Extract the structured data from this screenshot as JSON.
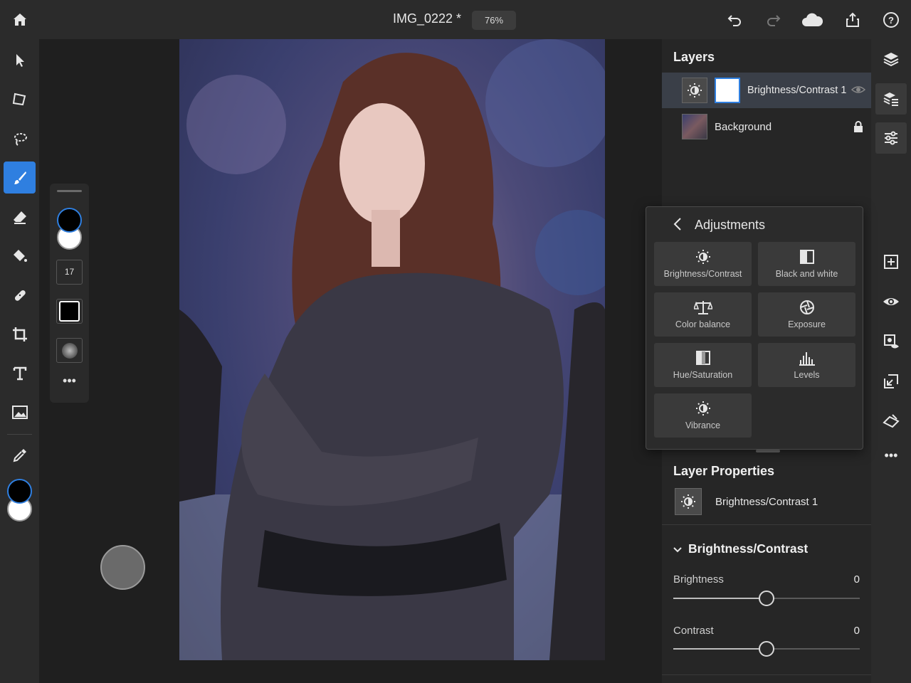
{
  "topbar": {
    "document_title": "IMG_0222 *",
    "zoom": "76%",
    "icons": [
      "home-icon",
      "undo-icon",
      "redo-icon",
      "cloud-icon",
      "share-icon",
      "help-icon"
    ]
  },
  "left_tools": [
    "select-icon",
    "transform-icon",
    "lasso-icon",
    "brush-icon",
    "eraser-icon",
    "fill-icon",
    "healing-icon",
    "crop-icon",
    "type-icon",
    "image-icon",
    "eyedropper-icon"
  ],
  "brush_panel": {
    "size": "17"
  },
  "layers": {
    "title": "Layers",
    "items": [
      {
        "name": "Brightness/Contrast 1",
        "selected": true
      },
      {
        "name": "Background",
        "locked": true
      }
    ]
  },
  "adjustments": {
    "title": "Adjustments",
    "items": [
      {
        "label": "Brightness/Contrast",
        "icon": "brightness-icon"
      },
      {
        "label": "Black and white",
        "icon": "black-white-icon"
      },
      {
        "label": "Color balance",
        "icon": "balance-icon"
      },
      {
        "label": "Exposure",
        "icon": "aperture-icon"
      },
      {
        "label": "Hue/Saturation",
        "icon": "hue-icon"
      },
      {
        "label": "Levels",
        "icon": "levels-icon"
      },
      {
        "label": "Vibrance",
        "icon": "vibrance-icon"
      }
    ]
  },
  "layer_properties": {
    "title": "Layer Properties",
    "layer_name": "Brightness/Contrast 1",
    "section": "Brightness/Contrast",
    "brightness_label": "Brightness",
    "brightness_value": "0",
    "contrast_label": "Contrast",
    "contrast_value": "0"
  },
  "colors": {
    "accent": "#2f7fe0",
    "panel": "#262626",
    "selected_row": "#3a3f48"
  }
}
